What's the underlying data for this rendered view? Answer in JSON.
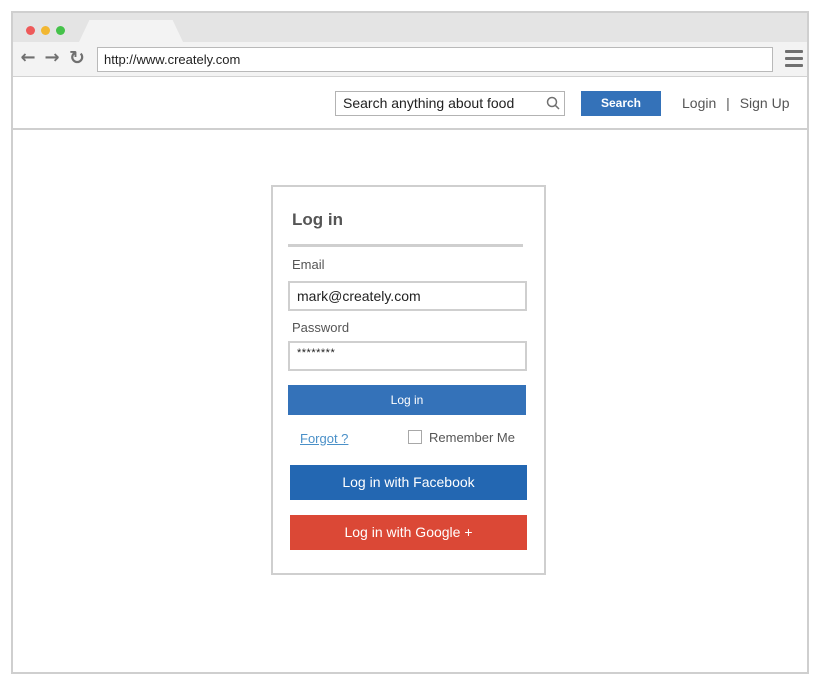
{
  "browser": {
    "url": "http://www.creately.com",
    "icons": {
      "back": "←",
      "forward": "→",
      "reload": "↻"
    }
  },
  "header": {
    "search_placeholder": "Search anything about food",
    "search_button": "Search",
    "login_link": "Login",
    "separator": "|",
    "signup_link": "Sign Up"
  },
  "login": {
    "title": "Log in",
    "email_label": "Email",
    "email_value": "mark@creately.com",
    "password_label": "Password",
    "password_value": "********",
    "login_button": "Log in",
    "forgot_link": "Forgot ?",
    "remember_label": "Remember Me",
    "facebook_button": "Log in with Facebook",
    "google_button": "Log in with Google +"
  },
  "colors": {
    "primary_blue": "#3472b9",
    "facebook_blue": "#2367b2",
    "google_red": "#db4836",
    "link_blue": "#4a90c8"
  }
}
